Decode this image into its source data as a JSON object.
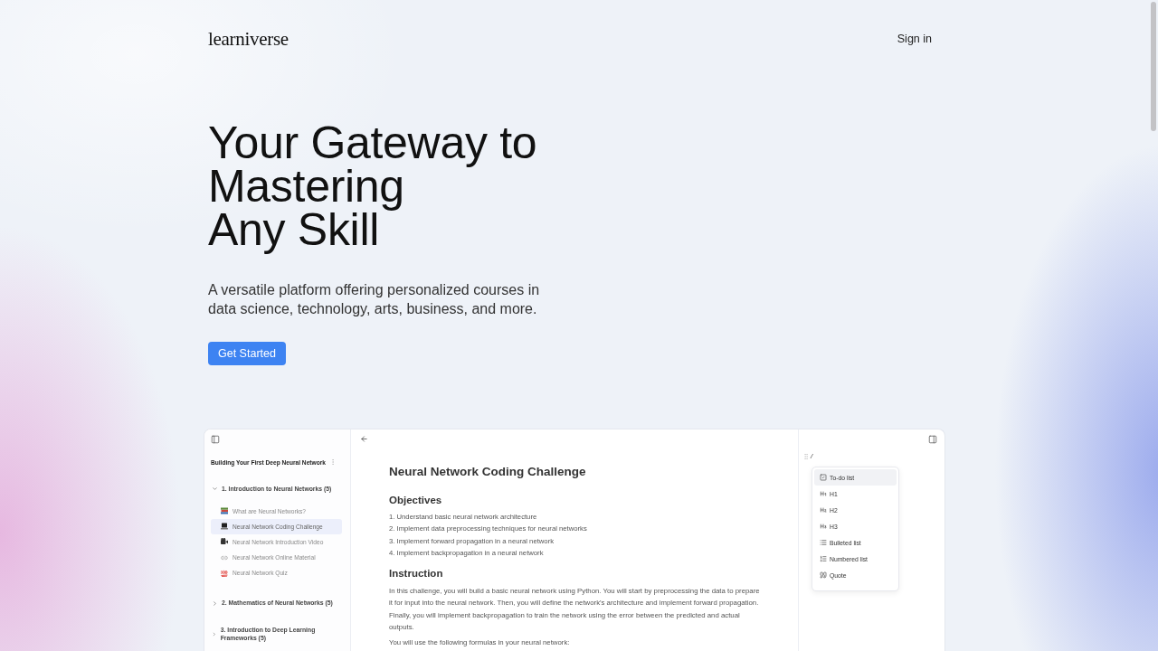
{
  "header": {
    "logo": "learniverse",
    "sign_in": "Sign in"
  },
  "hero": {
    "title_lines": [
      "Your Gateway to",
      "Mastering",
      "Any Skill"
    ],
    "subtitle": "A versatile platform offering personalized courses in data science, technology, arts, business, and more.",
    "cta": "Get Started"
  },
  "preview": {
    "sidebar": {
      "course_title": "Building Your First Deep Neural Network",
      "sections": [
        {
          "title": "1. Introduction to Neural Networks (5)",
          "expanded": true,
          "children": [
            {
              "kind": "books",
              "label": "What are Neural Networks?",
              "selected": false
            },
            {
              "kind": "laptop",
              "label": "Neural Network Coding Challenge",
              "selected": true
            },
            {
              "kind": "video",
              "label": "Neural Network Introduction Video",
              "selected": false
            },
            {
              "kind": "link",
              "label": "Neural Network Online Material",
              "selected": false
            },
            {
              "kind": "quiz",
              "label": "Neural Network Quiz",
              "selected": false
            }
          ]
        },
        {
          "title": "2. Mathematics of Neural Networks (5)",
          "expanded": false
        },
        {
          "title": "3. Introduction to Deep Learning Frameworks (5)",
          "expanded": false
        }
      ]
    },
    "document": {
      "title": "Neural Network Coding Challenge",
      "sections": [
        {
          "kind": "list",
          "heading": "Objectives",
          "items": [
            "1. Understand basic neural network architecture",
            "2. Implement data preprocessing techniques for neural networks",
            "3. Implement forward propagation in a neural network",
            "4. Implement backpropagation in a neural network"
          ]
        },
        {
          "kind": "paragraphs",
          "heading": "Instruction",
          "paragraphs": [
            "In this challenge, you will build a basic neural network using Python. You will start by preprocessing the data to prepare it for input into the neural network. Then, you will define the network's architecture and implement forward propagation. Finally, you will implement backpropagation to train the network using the error between the predicted and actual outputs.",
            "You will use the following formulas in your neural network:"
          ]
        }
      ]
    },
    "editor": {
      "typed_text": "/",
      "menu": [
        {
          "kind": "todo",
          "label": "To-do list",
          "selected": true
        },
        {
          "kind": "h1",
          "label": "H1",
          "selected": false
        },
        {
          "kind": "h2",
          "label": "H2",
          "selected": false
        },
        {
          "kind": "h3",
          "label": "H3",
          "selected": false
        },
        {
          "kind": "bulleted",
          "label": "Bulleted list",
          "selected": false
        },
        {
          "kind": "numbered",
          "label": "Numbered list",
          "selected": false
        },
        {
          "kind": "quote",
          "label": "Quote",
          "selected": false
        }
      ]
    }
  }
}
